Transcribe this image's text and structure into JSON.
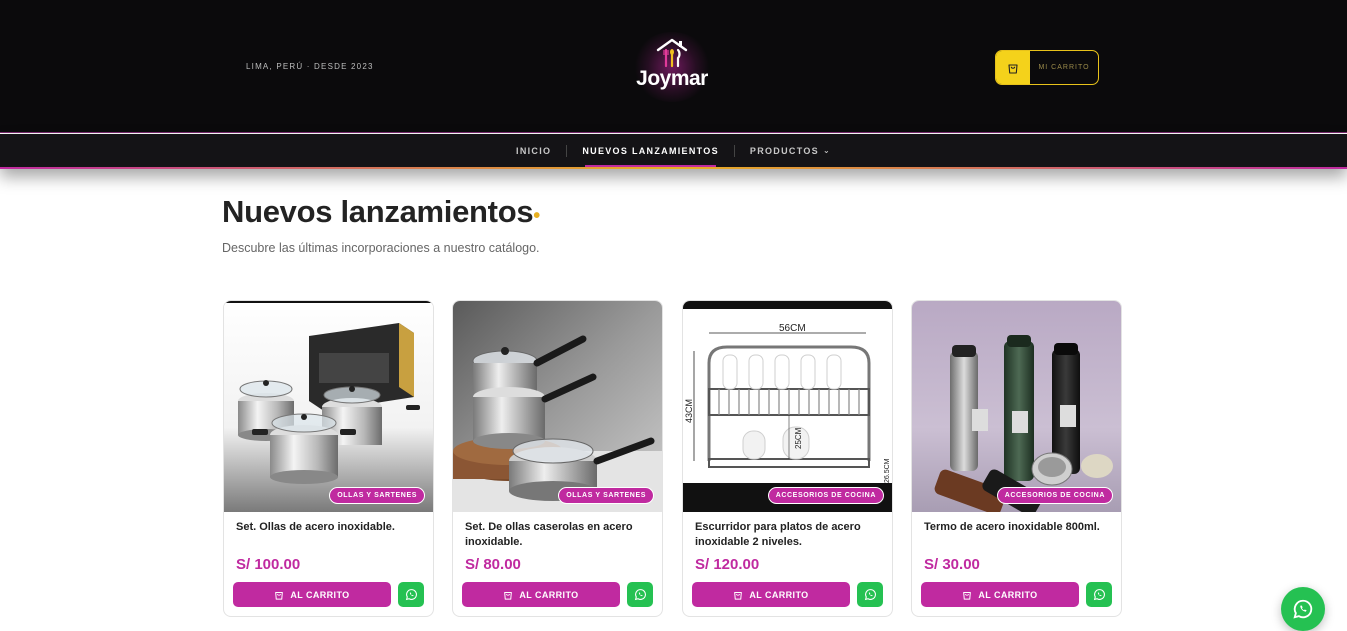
{
  "header": {
    "location": "LIMA, PERÚ · DESDE 2023",
    "brand": "Joymar",
    "cart_label": "MI CARRITO"
  },
  "nav": {
    "items": [
      {
        "label": "INICIO"
      },
      {
        "label": "NUEVOS LANZAMIENTOS"
      },
      {
        "label": "PRODUCTOS"
      }
    ]
  },
  "section": {
    "title": "Nuevos lanzamientos",
    "subtitle": "Descubre las últimas incorporaciones a nuestro catálogo."
  },
  "products": [
    {
      "name": "Set. Ollas de acero inoxidable.",
      "price": "S/ 100.00",
      "category": "OLLAS Y SARTENES",
      "add_label": "AL CARRITO"
    },
    {
      "name": "Set. De ollas caserolas en acero inoxidable.",
      "price": "S/ 80.00",
      "category": "OLLAS Y SARTENES",
      "add_label": "AL CARRITO"
    },
    {
      "name": "Escurridor para platos de acero inoxidable 2 niveles.",
      "price": "S/ 120.00",
      "category": "ACCESORIOS DE COCINA",
      "add_label": "AL CARRITO",
      "image_labels": {
        "width": "56CM",
        "height": "43CM",
        "inner": "25CM",
        "small": "26.5CM"
      }
    },
    {
      "name": "Termo de acero inoxidable 800ml.",
      "price": "S/ 30.00",
      "category": "ACCESORIOS DE COCINA",
      "add_label": "AL CARRITO"
    }
  ],
  "colors": {
    "accent": "#c02aa0",
    "gold": "#f4d21b",
    "whatsapp": "#25c152",
    "header_bg": "#0b0a0c"
  },
  "icons": {
    "cart": "shopping-bag-icon",
    "whatsapp": "whatsapp-icon",
    "chevron": "chevron-down-icon"
  }
}
